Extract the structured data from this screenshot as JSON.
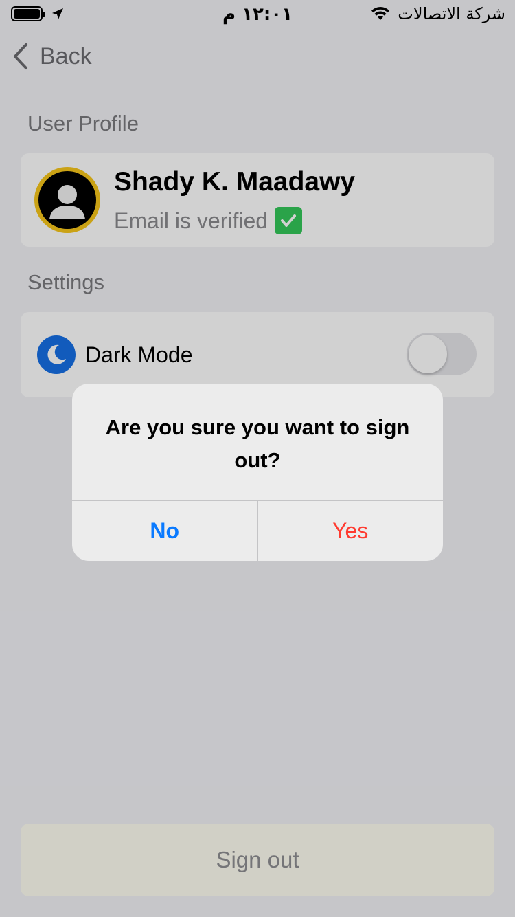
{
  "status_bar": {
    "time": "١٢:٠١ م",
    "carrier": "شركة الاتصالات"
  },
  "nav": {
    "back_label": "Back"
  },
  "profile": {
    "section_label": "User Profile",
    "name": "Shady K. Maadawy",
    "email_status": "Email is verified"
  },
  "settings": {
    "section_label": "Settings",
    "dark_mode_label": "Dark Mode",
    "dark_mode_enabled": false
  },
  "sign_out": {
    "label": "Sign out"
  },
  "dialog": {
    "message": "Are you sure you want to sign out?",
    "no_label": "No",
    "yes_label": "Yes"
  },
  "colors": {
    "accent_blue": "#0a7aff",
    "destructive_red": "#ff3b30",
    "avatar_ring": "#f7c61a",
    "moon_blue": "#1670e6",
    "check_green": "#34c759"
  },
  "icons": [
    "battery-icon",
    "location-arrow-icon",
    "wifi-icon",
    "chevron-left-icon",
    "user-avatar-icon",
    "checkmark-icon",
    "moon-icon"
  ]
}
